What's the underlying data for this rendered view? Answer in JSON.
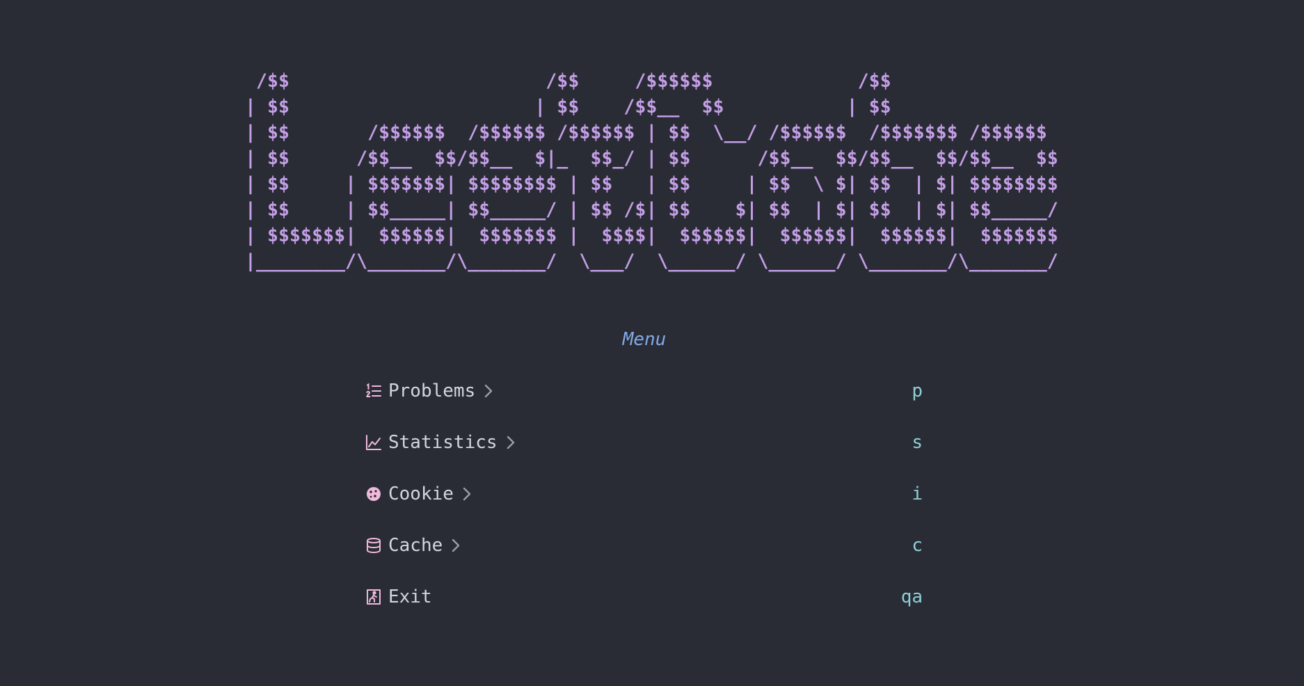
{
  "banner": {
    "lines": [
      " /$$                       /$$     /$$$$$$             /$$",
      "| $$                      | $$    /$$__  $$           | $$",
      "| $$       /$$$$$$  /$$$$$$ /$$$$$$ | $$  \\__/ /$$$$$$  /$$$$$$$ /$$$$$$",
      "| $$      /$$__  $$/$$__  $|_  $$_/ | $$      /$$__  $$/$$__  $$/$$__  $$",
      "| $$     | $$$$$$$| $$$$$$$$ | $$   | $$     | $$  \\ $| $$  | $| $$$$$$$$",
      "| $$     | $$_____| $$_____/ | $$ /$| $$    $| $$  | $| $$  | $| $$_____/",
      "| $$$$$$$|  $$$$$$|  $$$$$$$ |  $$$$|  $$$$$$|  $$$$$$|  $$$$$$|  $$$$$$$",
      "|________/\\_______/\\_______/  \\___/  \\______/ \\______/ \\_______/\\_______/"
    ],
    "color": "#c49ee6"
  },
  "menu": {
    "title": "Menu",
    "title_color": "#82aae8",
    "items": [
      {
        "label": "Problems",
        "key": "p",
        "icon": "numbered-list-icon",
        "submenu": true
      },
      {
        "label": "Statistics",
        "key": "s",
        "icon": "line-chart-icon",
        "submenu": true
      },
      {
        "label": "Cookie",
        "key": "i",
        "icon": "cookie-icon",
        "submenu": true
      },
      {
        "label": "Cache",
        "key": "c",
        "icon": "database-icon",
        "submenu": true
      },
      {
        "label": "Exit",
        "key": "qa",
        "icon": "exit-door-icon",
        "submenu": false
      }
    ],
    "icon_color": "#f1b9dc",
    "label_color": "#d2d6e0",
    "key_color": "#8ecfd6",
    "background": "#292c35"
  }
}
